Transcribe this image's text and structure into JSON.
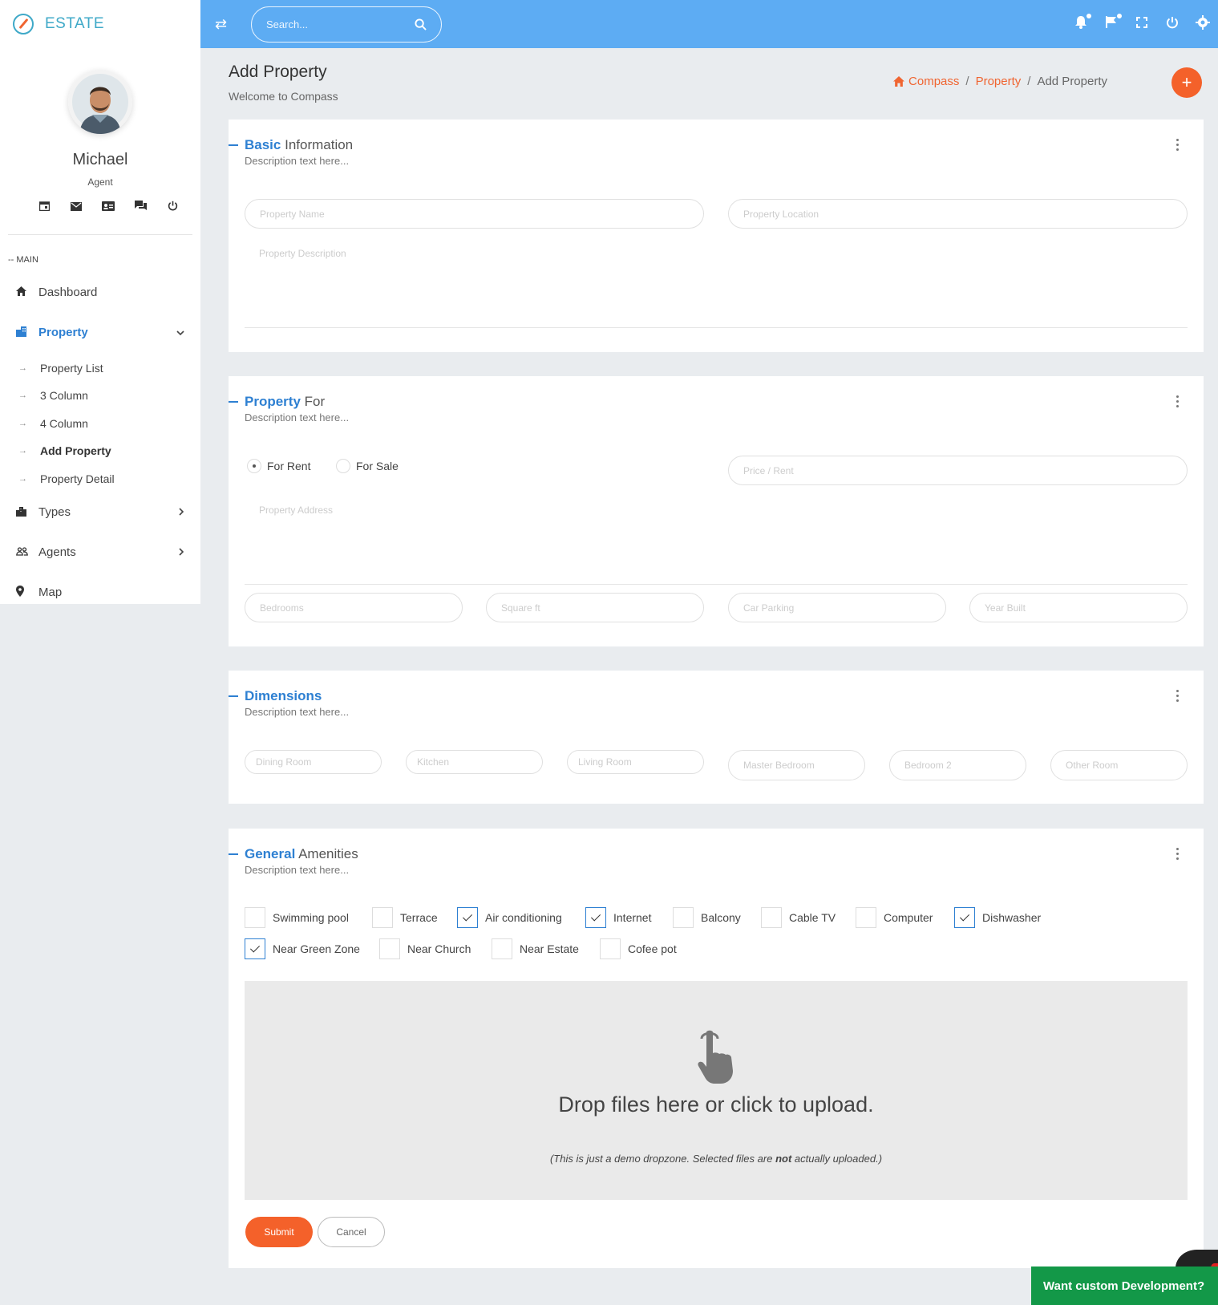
{
  "brand": {
    "name": "ESTATE"
  },
  "topbar": {
    "search_placeholder": "Search...",
    "icons": [
      "swap-icon",
      "search-icon",
      "bell-icon",
      "flag-icon",
      "fullscreen-icon",
      "power-icon",
      "gear-icon"
    ]
  },
  "user": {
    "name": "Michael",
    "role": "Agent"
  },
  "sidebar": {
    "section": "-- MAIN",
    "items": [
      {
        "label": "Dashboard",
        "icon": "home-icon"
      },
      {
        "label": "Property",
        "icon": "building-icon",
        "active": true
      },
      {
        "label": "Types",
        "icon": "city-icon"
      },
      {
        "label": "Agents",
        "icon": "users-icon"
      },
      {
        "label": "Map",
        "icon": "map-pin-icon"
      }
    ],
    "submenu": [
      "Property List",
      "3 Column",
      "4 Column",
      "Add Property",
      "Property Detail"
    ]
  },
  "page": {
    "title": "Add Property",
    "subtitle": "Welcome to Compass",
    "breadcrumb": [
      "Compass",
      "Property",
      "Add Property"
    ],
    "fab": "+"
  },
  "basic": {
    "title_bold": "Basic",
    "title_rest": " Information",
    "desc": "Description text here...",
    "name_ph": "Property Name",
    "location_ph": "Property Location",
    "description_ph": "Property Description"
  },
  "propfor": {
    "title_bold": "Property",
    "title_rest": " For",
    "desc": "Description text here...",
    "radio_rent": "For Rent",
    "radio_sale": "For Sale",
    "selected": "For Rent",
    "price_ph": "Price / Rent",
    "address_ph": "Property Address",
    "bedrooms_ph": "Bedrooms",
    "sqft_ph": "Square ft",
    "parking_ph": "Car Parking",
    "year_ph": "Year Built"
  },
  "dimensions": {
    "title_bold": "Dimensions",
    "desc": "Description text here...",
    "fields": [
      "Dining Room",
      "Kitchen",
      "Living Room",
      "Master Bedroom",
      "Bedroom 2",
      "Other Room"
    ]
  },
  "amenities": {
    "title_bold": "General",
    "title_rest": " Amenities",
    "desc": "Description text here...",
    "items": [
      {
        "label": "Swimming pool",
        "checked": false
      },
      {
        "label": "Terrace",
        "checked": false
      },
      {
        "label": "Air conditioning",
        "checked": true
      },
      {
        "label": "Internet",
        "checked": true
      },
      {
        "label": "Balcony",
        "checked": false
      },
      {
        "label": "Cable TV",
        "checked": false
      },
      {
        "label": "Computer",
        "checked": false
      },
      {
        "label": "Dishwasher",
        "checked": true
      },
      {
        "label": "Near Green Zone",
        "checked": true
      },
      {
        "label": "Near Church",
        "checked": false
      },
      {
        "label": "Near Estate",
        "checked": false
      },
      {
        "label": "Cofee pot",
        "checked": false
      }
    ]
  },
  "dropzone": {
    "title": "Drop files here or click to upload.",
    "note_pre": "(This is just a demo dropzone. Selected files are ",
    "note_bold": "not",
    "note_post": " actually uploaded.)"
  },
  "actions": {
    "submit": "Submit",
    "cancel": "Cancel"
  },
  "cta": {
    "label": "Want custom Development?"
  }
}
